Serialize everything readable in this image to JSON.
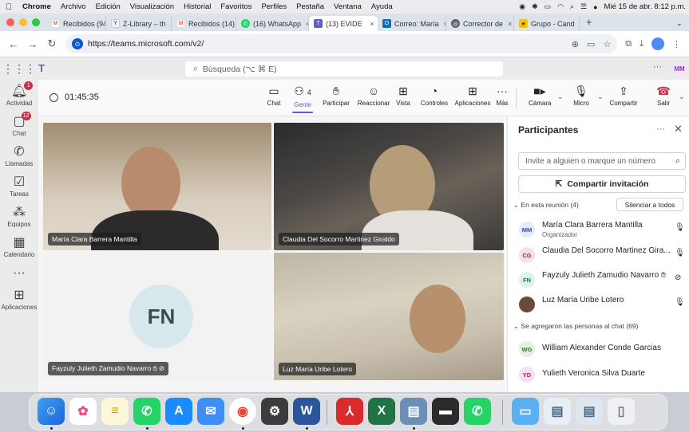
{
  "macos_menu": {
    "app": "Chrome",
    "items": [
      "Archivo",
      "Edición",
      "Visualización",
      "Historial",
      "Favoritos",
      "Perfiles",
      "Pestaña",
      "Ventana",
      "Ayuda"
    ],
    "clock": "Mié 15 de abr. 8:12 p.m."
  },
  "browser": {
    "tabs": [
      {
        "label": "Recibidos (94",
        "icon": "gmail-icon"
      },
      {
        "label": "Z-Library – th",
        "icon": "zlibrary-icon"
      },
      {
        "label": "Recibidos (14)",
        "icon": "gmail-icon"
      },
      {
        "label": "(16) WhatsApp",
        "icon": "whatsapp-icon"
      },
      {
        "label": "(13) EVIDE",
        "icon": "teams-icon",
        "active": true
      },
      {
        "label": "Correo: María",
        "icon": "outlook-icon"
      },
      {
        "label": "Corrector de",
        "icon": "corrector-icon"
      },
      {
        "label": "Grupo - Cand",
        "icon": "group-icon"
      }
    ],
    "url": "https://teams.microsoft.com/v2/"
  },
  "teams": {
    "search_placeholder": "Búsqueda (⌥ ⌘ E)",
    "user_initials": "MM",
    "rail": [
      {
        "label": "Actividad",
        "badge": "1"
      },
      {
        "label": "Chat",
        "badge": "12"
      },
      {
        "label": "Llamadas"
      },
      {
        "label": "Tareas"
      },
      {
        "label": "Equipos"
      },
      {
        "label": "Calendario"
      },
      {
        "label": ""
      },
      {
        "label": "Aplicaciones"
      }
    ],
    "meeting": {
      "timer": "01:45:35",
      "toolbar": {
        "chat": "Chat",
        "people": "Gente",
        "people_count": "4",
        "raise": "Participar",
        "react": "Reaccionar",
        "view": "Vista",
        "controls": "Controles",
        "apps": "Aplicaciones",
        "more": "Más",
        "camera": "Cámara",
        "mic": "Micro",
        "share": "Compartir",
        "leave": "Salir"
      },
      "tiles": [
        {
          "name": "María Clara Barrera Mantilla"
        },
        {
          "name": "Claudia Del Socorro Martinez Giraldo"
        },
        {
          "name": "Fayzuly Julieth Zamudio Navarro",
          "initials": "FN"
        },
        {
          "name": "Luz María Uribe Lotero"
        }
      ]
    },
    "participants": {
      "title": "Participantes",
      "invite_placeholder": "Invite a alguien o marque un número",
      "share_invite": "Compartir invitación",
      "in_meeting": "En esta reunión (4)",
      "mute_all": "Silenciar a todos",
      "people": [
        {
          "initials": "MM",
          "name": "María Clara Barrera Mantilla",
          "role": "Organizador"
        },
        {
          "initials": "CG",
          "name": "Claudia Del Socorro Martinez Gira..."
        },
        {
          "initials": "FN",
          "name": "Fayzuly Julieth Zamudio Navarro"
        },
        {
          "initials": "",
          "name": "Luz María Uribe Lotero"
        }
      ],
      "added_chat": "Se agregaron las personas al chat (69)",
      "chat_people": [
        {
          "initials": "WG",
          "name": "William Alexander Conde Garcias"
        },
        {
          "initials": "YD",
          "name": "Yulieth Veronica Silva Duarte"
        }
      ]
    }
  },
  "colors": {
    "teams_purple": "#5b5fc7",
    "leave_red": "#c4314b",
    "badge_red": "#c4314b"
  }
}
